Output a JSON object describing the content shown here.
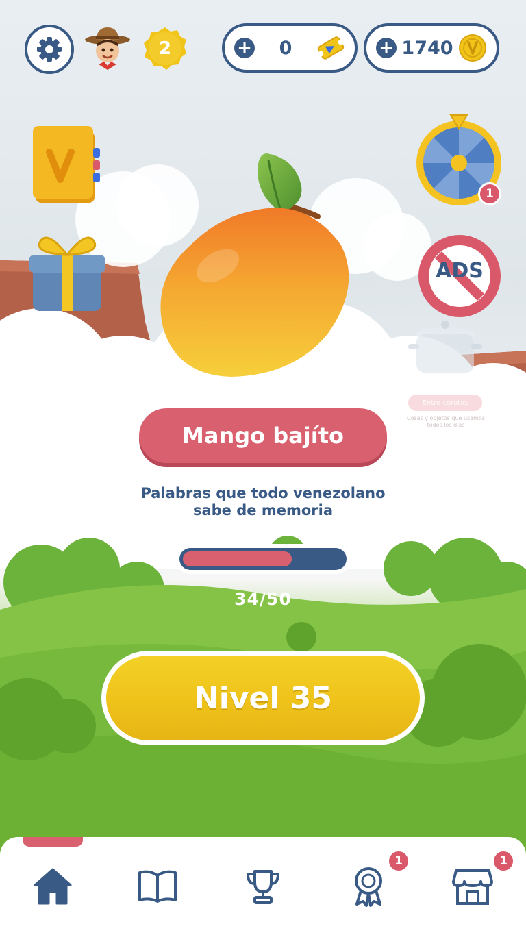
{
  "header": {
    "player_level": "2",
    "tickets": {
      "value": "0"
    },
    "coins": {
      "value": "1740"
    }
  },
  "side_buttons": {
    "dictionary_icon_letter": "V",
    "wheel_badge": "1",
    "noads_label": "ADS",
    "ghost_chip": "Entre corotos",
    "ghost_subtext": "Cosas y objetos que usamos todos los días"
  },
  "category": {
    "name": "Mango bajíto",
    "description_line1": "Palabras que todo venezolano",
    "description_line2": "sabe de memoria"
  },
  "progress": {
    "current": 34,
    "total": 50,
    "fraction": 0.68,
    "label": "34/50"
  },
  "play_button": {
    "label": "Nivel 35"
  },
  "nav": {
    "items": [
      {
        "icon": "home-icon",
        "active": true
      },
      {
        "icon": "book-icon",
        "active": false
      },
      {
        "icon": "trophy-icon",
        "active": false
      },
      {
        "icon": "medal-icon",
        "active": false,
        "badge": "1"
      },
      {
        "icon": "shop-icon",
        "active": false,
        "badge": "1"
      }
    ]
  },
  "colors": {
    "navy": "#3a5a86",
    "pink": "#d9606f",
    "yellow": "#efc21a",
    "grass": "#7bbd3f"
  }
}
